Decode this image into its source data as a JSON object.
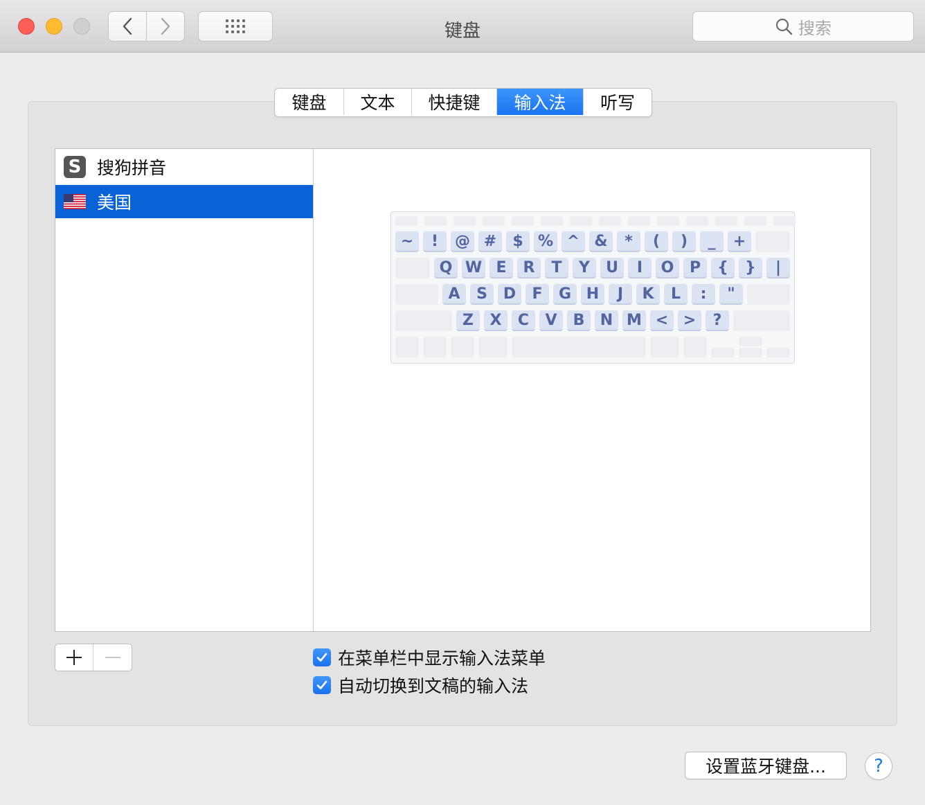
{
  "window": {
    "title": "键盘",
    "search_placeholder": "搜索"
  },
  "tabs": [
    {
      "label": "键盘",
      "active": false
    },
    {
      "label": "文本",
      "active": false
    },
    {
      "label": "快捷键",
      "active": false
    },
    {
      "label": "输入法",
      "active": true
    },
    {
      "label": "听写",
      "active": false
    }
  ],
  "input_sources": [
    {
      "label": "搜狗拼音",
      "icon": "sogou-icon",
      "selected": false
    },
    {
      "label": "美国",
      "icon": "us-flag-icon",
      "selected": true
    }
  ],
  "keyboard_preview": {
    "row_symbols": [
      "~",
      "!",
      "@",
      "#",
      "$",
      "%",
      "^",
      "&",
      "*",
      "(",
      ")",
      "_",
      "+"
    ],
    "row_top": [
      "Q",
      "W",
      "E",
      "R",
      "T",
      "Y",
      "U",
      "I",
      "O",
      "P",
      "{",
      "}",
      "|"
    ],
    "row_home": [
      "A",
      "S",
      "D",
      "F",
      "G",
      "H",
      "J",
      "K",
      "L",
      ":",
      "\""
    ],
    "row_bottom": [
      "Z",
      "X",
      "C",
      "V",
      "B",
      "N",
      "M",
      "<",
      ">",
      "?"
    ]
  },
  "options": [
    {
      "label": "在菜单栏中显示输入法菜单",
      "checked": true
    },
    {
      "label": "自动切换到文稿的输入法",
      "checked": true
    }
  ],
  "buttons": {
    "bluetooth": "设置蓝牙键盘...",
    "help": "?"
  },
  "colors": {
    "accent": "#1a74f0",
    "selection": "#0963d6",
    "key_label": "#5265a0"
  }
}
